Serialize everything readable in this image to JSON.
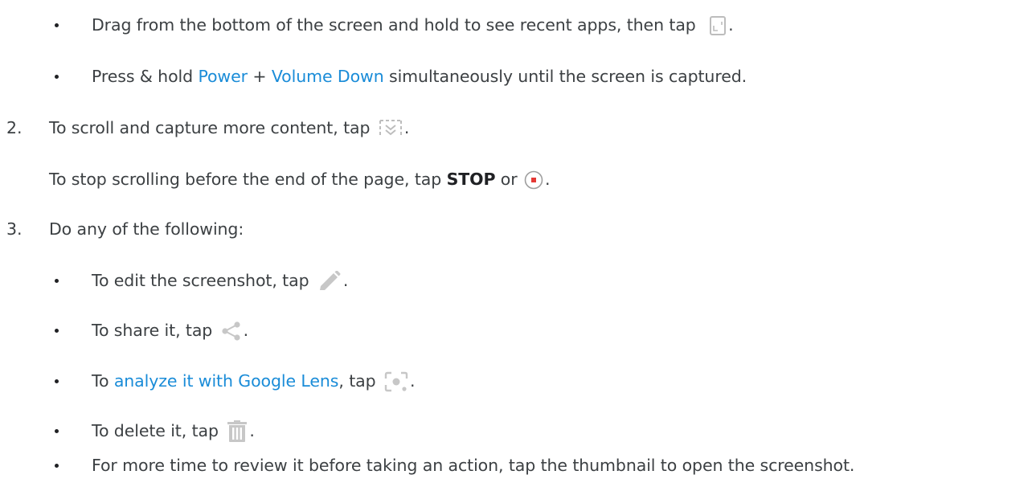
{
  "items": {
    "b1": {
      "text1": "Drag from the bottom of the screen and hold to see recent apps, then tap",
      "text2": ".",
      "icon": "phone-screenshot-icon"
    },
    "b2": {
      "link1": "Power",
      "text1": " + ",
      "link2": "Volume Down",
      "text2": " simultaneously until the screen is captured.",
      "prefix": "Press & hold "
    },
    "s2": {
      "number": "2.",
      "text1": "To scroll and capture more content, tap",
      "text2": ".",
      "icon": "scroll-capture-icon"
    },
    "s2b": {
      "text1": "To stop scrolling before the end of the page, tap ",
      "bold": "STOP",
      "text2": " or ",
      "text3": ".",
      "icon": "stop-record-icon"
    },
    "s3": {
      "number": "3.",
      "text1": "Do any of the following:"
    },
    "e1": {
      "text1": "To edit the screenshot, tap",
      "text2": ".",
      "icon": "pencil-icon"
    },
    "e2": {
      "text1": "To share it, tap",
      "text2": ".",
      "icon": "share-icon"
    },
    "e3": {
      "prefix": "To ",
      "link": "analyze it with Google Lens",
      "text1": ", tap",
      "text2": ".",
      "icon": "lens-icon"
    },
    "e4": {
      "text1": "To delete it, tap",
      "text2": ".",
      "icon": "trash-icon"
    },
    "e5": {
      "text1": "For more time to review it before taking an action, tap the thumbnail to open the screenshot."
    }
  },
  "colors": {
    "text": "#3c4043",
    "link": "#1a8cd8",
    "icon_gray": "#bdbdbd",
    "stop_red": "#e53935"
  }
}
